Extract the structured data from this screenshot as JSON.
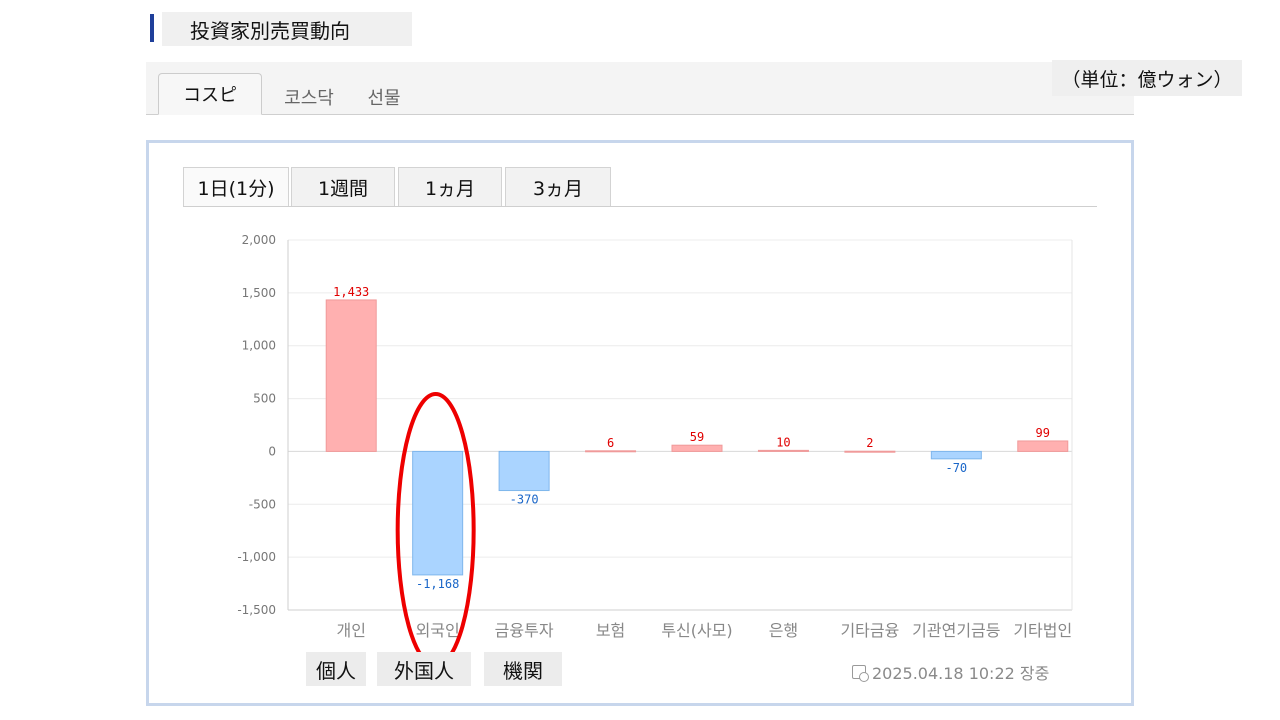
{
  "header": {
    "title": "投資家別売買動向",
    "unit": "（単位：億ウォン）"
  },
  "market_tabs": [
    "コスピ",
    "코스닥",
    "선물"
  ],
  "period_tabs": [
    "1日(1分)",
    "1週間",
    "1ヵ月",
    "3ヵ月"
  ],
  "annotations": [
    "個人",
    "外国人",
    "機関"
  ],
  "timestamp": "2025.04.18 10:22 장중",
  "colors": {
    "positive_fill": "#ffb0b0",
    "positive_stroke": "#f09a9a",
    "negative_fill": "#aad4ff",
    "negative_stroke": "#7fb6ec",
    "positive_text": "#e00000",
    "negative_text": "#1a66c8",
    "highlight": "#ee0000"
  },
  "chart_data": {
    "type": "bar",
    "categories": [
      "개인",
      "외국인",
      "금융투자",
      "보험",
      "투신(사모)",
      "은행",
      "기타금융",
      "기관연기금등",
      "기타법인"
    ],
    "values": [
      1433,
      -1168,
      -370,
      6,
      59,
      10,
      2,
      -70,
      99
    ],
    "value_labels": [
      "1,433",
      "-1,168",
      "-370",
      "6",
      "59",
      "10",
      "2",
      "-70",
      "99"
    ],
    "y_ticks": [
      "2,000",
      "1,500",
      "1,000",
      "500",
      "0",
      "-500",
      "-1,000",
      "-1,500"
    ],
    "ylim": [
      -1500,
      2000
    ],
    "grid": true,
    "highlighted_category": "외국인"
  }
}
